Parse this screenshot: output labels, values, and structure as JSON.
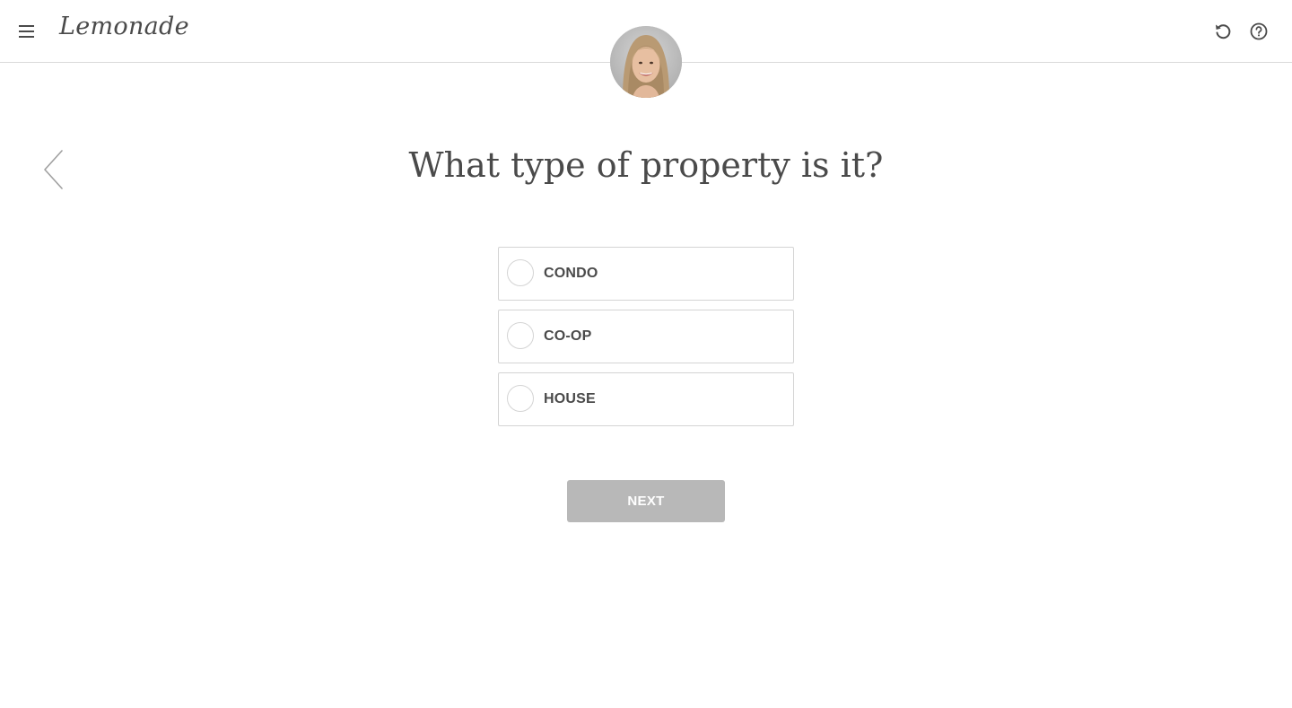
{
  "header": {
    "logo_text": "Lemonade",
    "menu_icon": "hamburger-icon",
    "restart_icon": "restart-icon",
    "help_icon": "help-icon"
  },
  "assistant": {
    "avatar_icon": "assistant-avatar"
  },
  "question": {
    "title": "What type of property is it?",
    "options": [
      {
        "label": "CONDO"
      },
      {
        "label": "CO-OP"
      },
      {
        "label": "HOUSE"
      }
    ]
  },
  "actions": {
    "next_label": "NEXT"
  },
  "colors": {
    "text": "#4a4a4a",
    "border": "#d4d4d4",
    "button_disabled": "#b8b8b8"
  }
}
